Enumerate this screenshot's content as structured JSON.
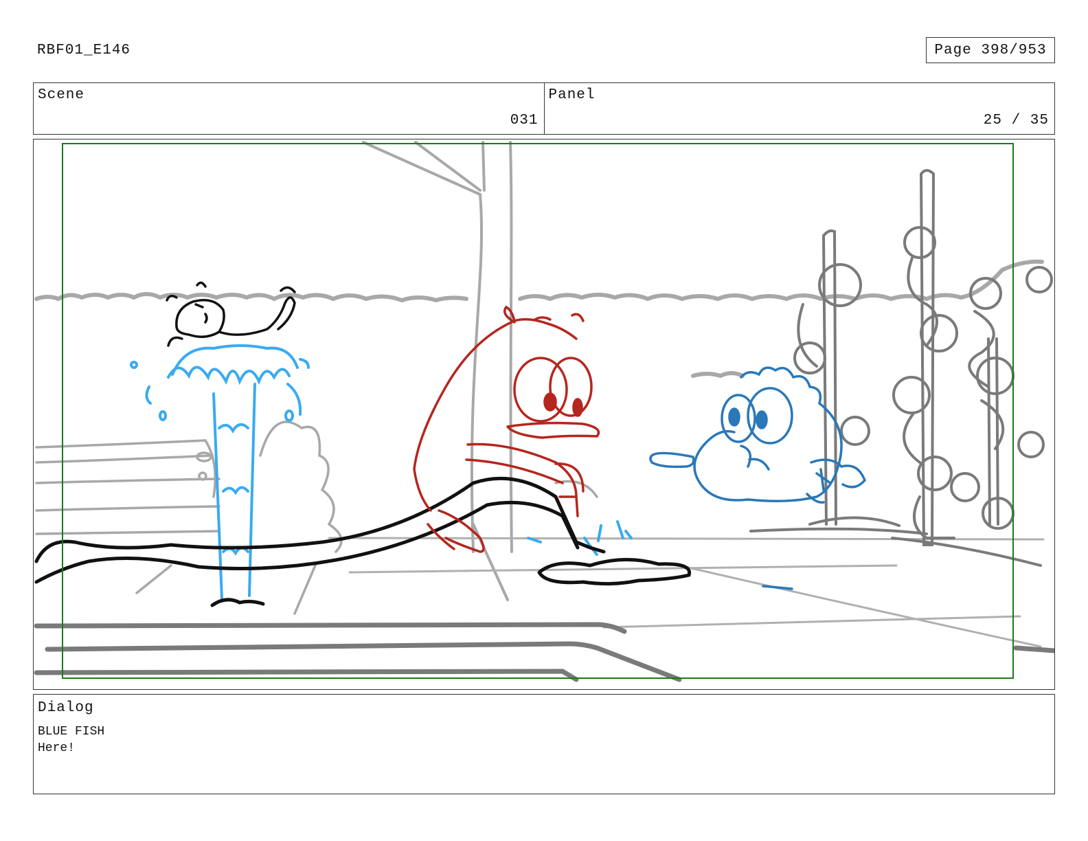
{
  "header": {
    "doc_id": "RBF01_E146",
    "page_label": "Page 398/953"
  },
  "info": {
    "scene_label": "Scene",
    "scene_value": "031",
    "panel_label": "Panel",
    "panel_value": "25 / 35"
  },
  "panel": {
    "safe_frame_color": "#1a7a1a",
    "colors": {
      "background_lines": "#a8a8a8",
      "dark_gray": "#7a7a7a",
      "red_character": "#b5261e",
      "blue_character": "#2a78b8",
      "water": "#3aaaf0",
      "ink": "#111111"
    }
  },
  "dialog": {
    "label": "Dialog",
    "speaker": "BLUE FISH",
    "line": "Here!"
  }
}
